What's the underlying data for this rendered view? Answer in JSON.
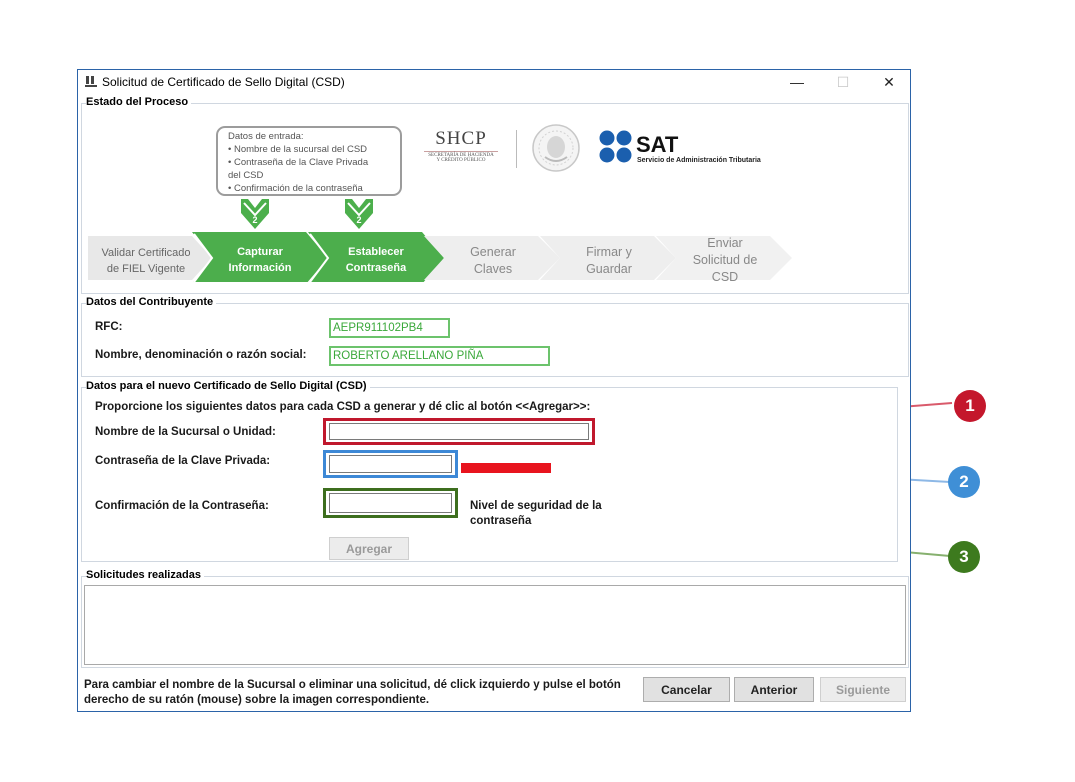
{
  "window": {
    "title": "Solicitud de Certificado de Sello Digital (CSD)",
    "minimize_glyph": "—",
    "maximize_glyph": "☐",
    "close_glyph": "✕"
  },
  "process": {
    "group_label": "Estado del Proceso",
    "info_box_lines": [
      "Datos de entrada:",
      "• Nombre de la sucursal del CSD",
      "• Contraseña de la Clave Privada",
      "del CSD",
      "• Confirmación de la contraseña"
    ],
    "markers": [
      "2",
      "2"
    ],
    "shcp": {
      "title": "SHCP",
      "line1": "SECRETARÍA DE HACIENDA",
      "line2": "Y CRÉDITO PÚBLICO"
    },
    "sat": {
      "title": "SAT",
      "subtitle": "Servicio de Administración Tributaria"
    },
    "steps": [
      {
        "line1": "Validar Certificado",
        "line2": "de FIEL Vigente",
        "line3": "",
        "state": "done"
      },
      {
        "line1": "Capturar",
        "line2": "Información",
        "line3": "",
        "state": "active"
      },
      {
        "line1": "Establecer",
        "line2": "Contraseña",
        "line3": "",
        "state": "active"
      },
      {
        "line1": "Generar",
        "line2": "Claves",
        "line3": "",
        "state": "pending"
      },
      {
        "line1": "Firmar y",
        "line2": "Guardar",
        "line3": "",
        "state": "pending"
      },
      {
        "line1": "Enviar",
        "line2": "Solicitud de",
        "line3": "CSD",
        "state": "pending"
      }
    ]
  },
  "contribuyente": {
    "group_label": "Datos del Contribuyente",
    "rfc_label": "RFC:",
    "rfc_value": "AEPR911102PB4",
    "name_label": "Nombre, denominación o razón social:",
    "name_value": "ROBERTO ARELLANO PIÑA"
  },
  "csd": {
    "group_label": "Datos para el nuevo Certificado de Sello Digital (CSD)",
    "instruction": "Proporcione los siguientes datos para cada CSD a generar y dé clic al botón <<Agregar>>:",
    "branch_label": "Nombre de la Sucursal o Unidad:",
    "branch_value": "",
    "password_label": "Contraseña de la Clave Privada:",
    "password_value": "",
    "confirm_label": "Confirmación de la Contraseña:",
    "confirm_value": "",
    "security_label_1": "Nivel de seguridad de la",
    "security_label_2": "contraseña",
    "security_level_color": "#e8141e",
    "add_button": "Agregar"
  },
  "solicitudes": {
    "group_label": "Solicitudes realizadas"
  },
  "footer": {
    "help_line1": "Para cambiar el nombre de la Sucursal o eliminar una solicitud, dé click izquierdo y pulse el botón",
    "help_line2": "derecho de su ratón (mouse) sobre la imagen correspondiente.",
    "cancel_button": "Cancelar",
    "back_button": "Anterior",
    "next_button": "Siguiente"
  },
  "callouts": [
    {
      "number": "1",
      "color": "#c4172c"
    },
    {
      "number": "2",
      "color": "#3f8fd6"
    },
    {
      "number": "3",
      "color": "#3d7a1e"
    }
  ]
}
